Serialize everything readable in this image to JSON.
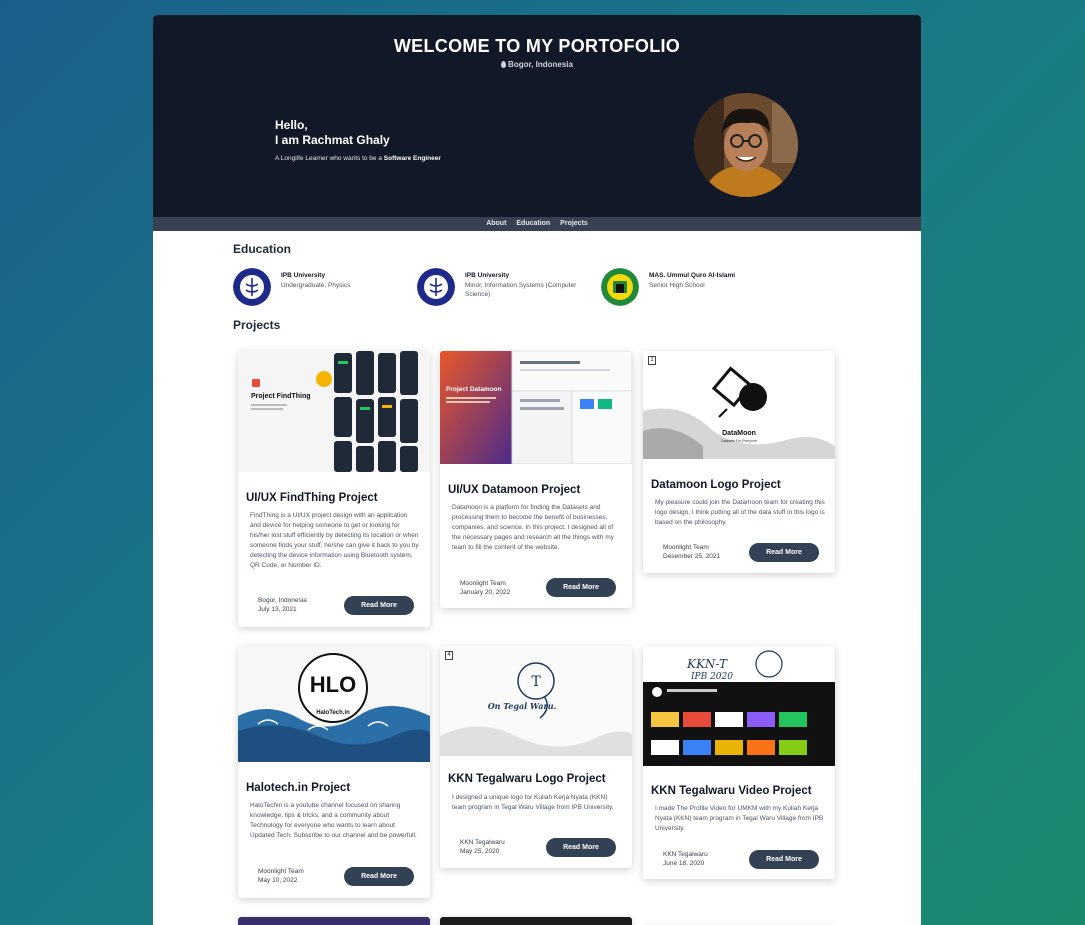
{
  "hero": {
    "title": "WELCOME TO MY PORTOFOLIO",
    "location": "Bogor, Indonesia",
    "hello_line1": "Hello,",
    "hello_line2": "I am Rachmat Ghaly",
    "tagline_prefix": "A Longlife Learner who wants to be a ",
    "tagline_highlight": "Software Engineer"
  },
  "nav": {
    "items": [
      "About",
      "Education",
      "Projects"
    ]
  },
  "education": {
    "title": "Education",
    "items": [
      {
        "name": "IPB University",
        "desc": "Undergraduate, Physics"
      },
      {
        "name": "IPB University",
        "desc": "Minor, Information Systems (Computer Science)"
      },
      {
        "name": "MAS. Ummul Quro Al-Islami",
        "desc": "Senior High School"
      }
    ]
  },
  "projects": {
    "title": "Projects",
    "read_more": "Read More",
    "cards": [
      {
        "title": "UI/UX FindThing Project",
        "desc": "FindThing is a UI/UX project design with an application and device for helping someone to get or looking for his/her lost stuff efficiently by detecting its location or when someone finds your stuff, he/she can give it back to you by detecting the device information using Bluetooth system, QR Code, or Number ID.",
        "author": "Bogor, Indonesia",
        "date": "July 13, 2021",
        "img_text": "Project FindThing"
      },
      {
        "title": "UI/UX Datamoon Project",
        "desc": "Datamoon is a platform for finding the Datasets and processing them to become the benefit of businesses, companies, and science. In this project, I designed all of the necessary pages and research all the things with my team to fill the content of the website.",
        "author": "Moonlight Team",
        "date": "January 20, 2022",
        "img_text": "Project Datamoon"
      },
      {
        "title": "Datamoon Logo Project",
        "desc": "My pleasure could join the Datamoon team for creating this logo design. I think putting all of the data stuff in this logo is based on the philosophy.",
        "author": "Moonlight Team",
        "date": "Desember 25, 2021",
        "img_text": "DataMoon",
        "img_sub": "Datasets For Everyone",
        "badge": "1"
      },
      {
        "title": "Halotech.in Project",
        "desc": "HaloTechin is a youtube channel focused on sharing knowledge, tips & tricks, and a community about Technology for everyone who wants to learn about Updated Tech. Subscribe to our channel and be powerfull.",
        "author": "Moonlight Team",
        "date": "May 10, 2022",
        "img_text": "HaloTech.in"
      },
      {
        "title": "KKN Tegalwaru Logo Project",
        "desc": "I designed a unique logo for Kuliah Kerja Nyata (KKN) team program in Tegal Waru Village from IPB University.",
        "author": "KKN Tegalwaru",
        "date": "May 25, 2020",
        "img_text": "On Tegal Waru.",
        "badge": "4"
      },
      {
        "title": "KKN Tegalwaru Video Project",
        "desc": "I made The Profile Video for UMKM with my Kuliah Kerja Nyata (KKN) team program in Tegal Waru Village from IPB University.",
        "author": "KKN Tegalwaru",
        "date": "June 18, 2020",
        "img_text": "KKN-T",
        "img_sub": "IPB 2020"
      }
    ]
  },
  "colors": {
    "hero_bg": "#111827",
    "nav_bg": "#374151",
    "button_bg": "#334155",
    "accent_green": "#1a8a6e",
    "accent_blue": "#1a5f8a"
  }
}
